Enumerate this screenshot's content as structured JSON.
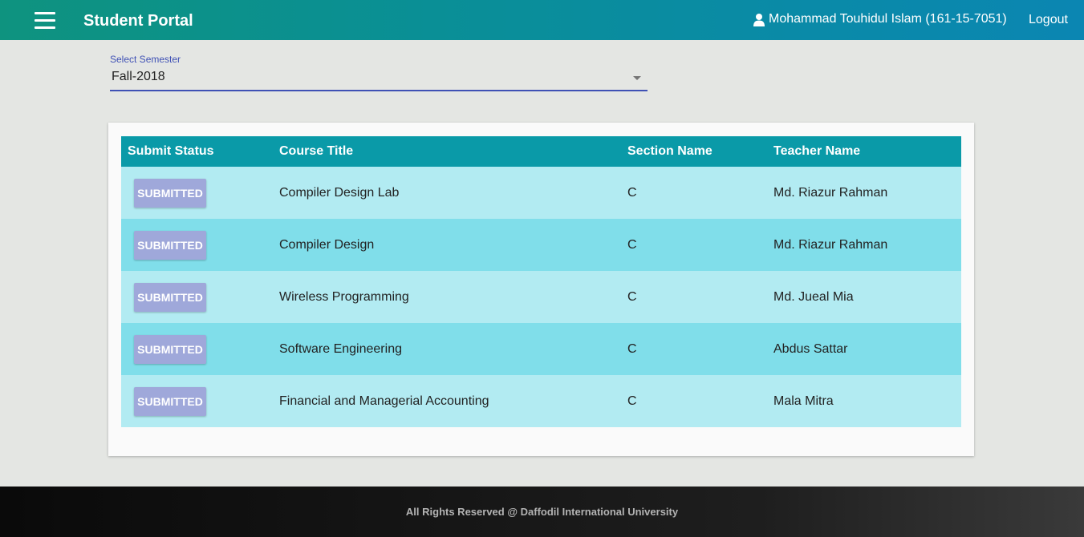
{
  "header": {
    "title": "Student Portal",
    "user_name": "Mohammad Touhidul Islam (161-15-7051)",
    "logout_label": "Logout",
    "menu_icon": "hamburger-menu-icon",
    "user_icon": "user-icon"
  },
  "semester": {
    "label": "Select Semester",
    "selected": "Fall-2018"
  },
  "table": {
    "headers": [
      "Submit Status",
      "Course Title",
      "Section Name",
      "Teacher Name"
    ],
    "rows": [
      {
        "status": "SUBMITTED",
        "course": "Compiler Design Lab",
        "section": "C",
        "teacher": "Md. Riazur Rahman"
      },
      {
        "status": "SUBMITTED",
        "course": "Compiler Design",
        "section": "C",
        "teacher": "Md. Riazur Rahman"
      },
      {
        "status": "SUBMITTED",
        "course": "Wireless Programming",
        "section": "C",
        "teacher": "Md. Jueal Mia"
      },
      {
        "status": "SUBMITTED",
        "course": "Software Engineering",
        "section": "C",
        "teacher": "Abdus Sattar"
      },
      {
        "status": "SUBMITTED",
        "course": "Financial and Managerial Accounting",
        "section": "C",
        "teacher": "Mala Mitra"
      }
    ]
  },
  "footer": {
    "text": "All Rights Reserved @ Daffodil International University"
  },
  "colors": {
    "accent": "#3f51b5",
    "table_header": "#0a9aa8",
    "row_light": "#b2ebf2",
    "row_dark": "#80deea",
    "status_button": "#9fa8da"
  }
}
